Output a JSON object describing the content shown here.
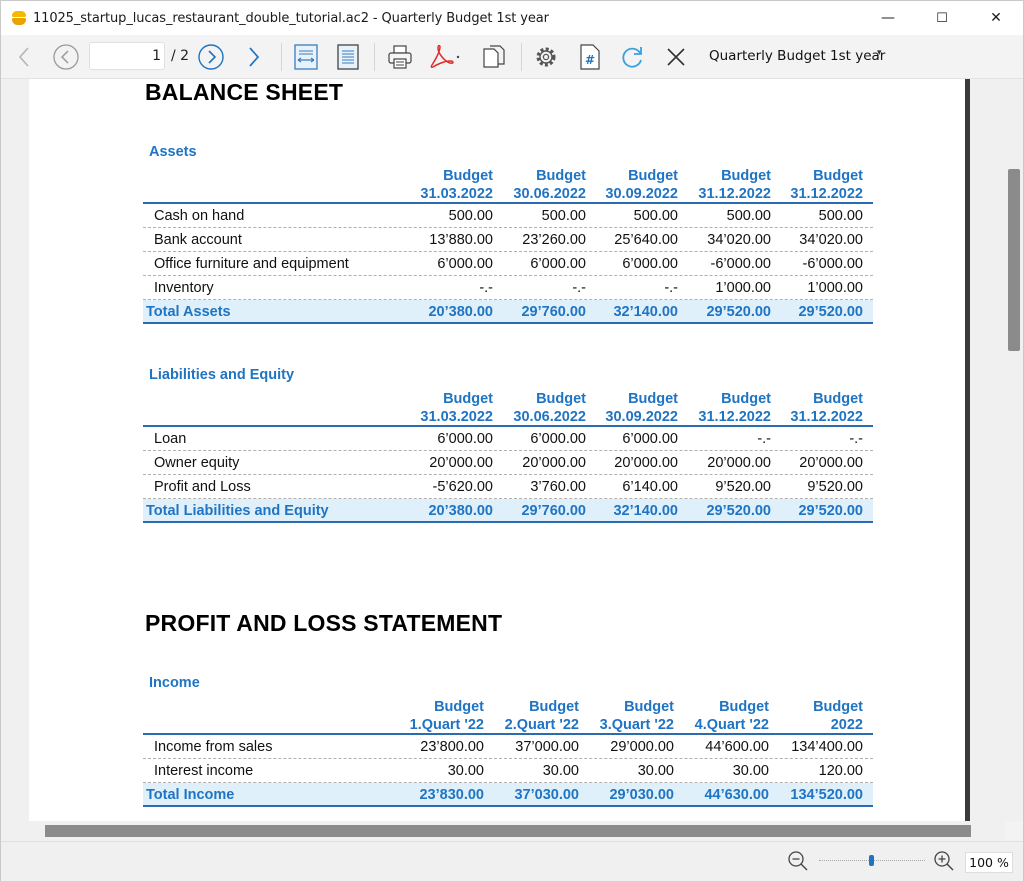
{
  "window": {
    "title": "11025_startup_lucas_restaurant_double_tutorial.ac2 - Quarterly Budget 1st year",
    "minimize": "—",
    "maximize": "☐",
    "close": "✕"
  },
  "toolbar": {
    "page_current": "1",
    "page_total": "/ 2",
    "report_name": "Quarterly Budget 1st year",
    "report_caret": "▾",
    "icons": [
      "back-arrow-icon",
      "prev-page-icon",
      "next-page-icon",
      "forward-arrow-icon",
      "fit-width-icon",
      "fit-page-icon",
      "print-icon",
      "pdf-icon",
      "copy-icon",
      "settings-icon",
      "hash-document-icon",
      "refresh-icon",
      "close-icon"
    ]
  },
  "report": {
    "balance_sheet": {
      "heading": "BALANCE SHEET",
      "assets": {
        "section_title": "Assets",
        "header_line1": [
          "Budget",
          "Budget",
          "Budget",
          "Budget",
          "Budget"
        ],
        "header_line2": [
          "31.03.2022",
          "30.06.2022",
          "30.09.2022",
          "31.12.2022",
          "31.12.2022"
        ],
        "rows": [
          {
            "label": "Cash on hand",
            "values": [
              "500.00",
              "500.00",
              "500.00",
              "500.00",
              "500.00"
            ]
          },
          {
            "label": "Bank account",
            "values": [
              "13’880.00",
              "23’260.00",
              "25’640.00",
              "34’020.00",
              "34’020.00"
            ]
          },
          {
            "label": "Office furniture and equipment",
            "values": [
              "6’000.00",
              "6’000.00",
              "6’000.00",
              "-6’000.00",
              "-6’000.00"
            ]
          },
          {
            "label": "Inventory",
            "values": [
              "-.-",
              "-.-",
              "-.-",
              "1’000.00",
              "1’000.00"
            ]
          }
        ],
        "total": {
          "label": "Total Assets",
          "values": [
            "20’380.00",
            "29’760.00",
            "32’140.00",
            "29’520.00",
            "29’520.00"
          ]
        }
      },
      "liabilities": {
        "section_title": "Liabilities and Equity",
        "header_line1": [
          "Budget",
          "Budget",
          "Budget",
          "Budget",
          "Budget"
        ],
        "header_line2": [
          "31.03.2022",
          "30.06.2022",
          "30.09.2022",
          "31.12.2022",
          "31.12.2022"
        ],
        "rows": [
          {
            "label": "Loan",
            "values": [
              "6’000.00",
              "6’000.00",
              "6’000.00",
              "-.-",
              "-.-"
            ]
          },
          {
            "label": "Owner equity",
            "values": [
              "20’000.00",
              "20’000.00",
              "20’000.00",
              "20’000.00",
              "20’000.00"
            ]
          },
          {
            "label": "Profit and Loss",
            "values": [
              "-5’620.00",
              "3’760.00",
              "6’140.00",
              "9’520.00",
              "9’520.00"
            ]
          }
        ],
        "total": {
          "label": "Total Liabilities and Equity",
          "values": [
            "20’380.00",
            "29’760.00",
            "32’140.00",
            "29’520.00",
            "29’520.00"
          ]
        }
      }
    },
    "profit_loss": {
      "heading": "PROFIT AND LOSS STATEMENT",
      "income": {
        "section_title": "Income",
        "header_line1": [
          "Budget",
          "Budget",
          "Budget",
          "Budget",
          "Budget"
        ],
        "header_line2": [
          "1.Quart '22",
          "2.Quart '22",
          "3.Quart '22",
          "4.Quart '22",
          "2022"
        ],
        "rows": [
          {
            "label": "Income from sales",
            "values": [
              "23’800.00",
              "37’000.00",
              "29’000.00",
              "44’600.00",
              "134’400.00"
            ]
          },
          {
            "label": "Interest income",
            "values": [
              "30.00",
              "30.00",
              "30.00",
              "30.00",
              "120.00"
            ]
          }
        ],
        "total": {
          "label": "Total Income",
          "values": [
            "23’830.00",
            "37’030.00",
            "29’030.00",
            "44’630.00",
            "134’520.00"
          ]
        }
      }
    }
  },
  "statusbar": {
    "zoom_level": "100 %",
    "zoom_fraction": 0.5
  },
  "colors": {
    "accent": "#1f74c3",
    "total_bg": "#dff0fa",
    "rule": "#2a6bb2"
  }
}
